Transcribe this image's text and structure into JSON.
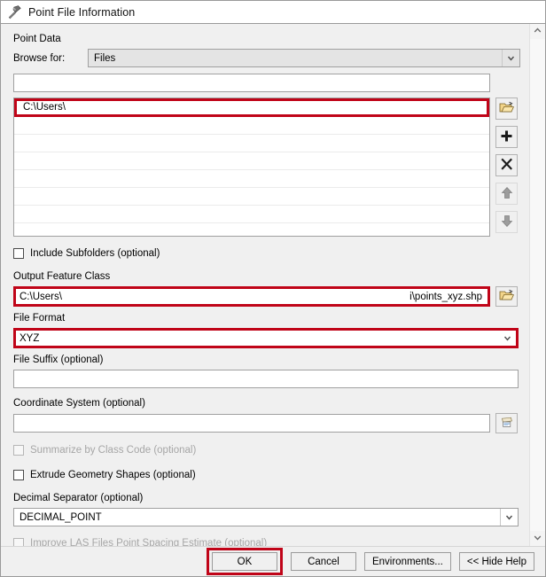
{
  "window": {
    "title": "Point File Information",
    "icon": "hammer-icon"
  },
  "colors": {
    "highlight_red": "#c00418",
    "dialog_background": "#f0f0f0",
    "field_background": "#ffffff",
    "combo_disabled_background": "#e4e4e4"
  },
  "point_data": {
    "group_label": "Point Data",
    "browse_for_label": "Browse for:",
    "browse_for_value": "Files",
    "path_input_value": "",
    "list_rows": [
      {
        "value": "C:\\Users\\",
        "selected": true
      },
      {
        "value": "",
        "selected": false
      },
      {
        "value": "",
        "selected": false
      },
      {
        "value": "",
        "selected": false
      },
      {
        "value": "",
        "selected": false
      },
      {
        "value": "",
        "selected": false
      },
      {
        "value": "",
        "selected": false
      }
    ],
    "tools": [
      {
        "name": "open-folder-icon",
        "title": "Browse"
      },
      {
        "name": "plus-icon",
        "title": "Add"
      },
      {
        "name": "close-x-icon",
        "title": "Remove"
      },
      {
        "name": "arrow-up-icon",
        "title": "Move Up"
      },
      {
        "name": "arrow-down-icon",
        "title": "Move Down"
      }
    ]
  },
  "include_subfolders": {
    "label": "Include Subfolders (optional)",
    "checked": false,
    "enabled": true
  },
  "output_feature_class": {
    "label": "Output Feature Class",
    "value_left": "C:\\Users\\",
    "value_right": "i\\points_xyz.shp",
    "browse_icon": "open-folder-icon"
  },
  "file_format": {
    "label": "File Format",
    "value": "XYZ"
  },
  "file_suffix": {
    "label": "File Suffix (optional)",
    "value": ""
  },
  "coordinate_system": {
    "label": "Coordinate System (optional)",
    "value": "",
    "browse_icon": "coordinate-system-icon"
  },
  "summarize_by_class_code": {
    "label": "Summarize by Class Code (optional)",
    "checked": false,
    "enabled": false
  },
  "extrude_geometry_shapes": {
    "label": "Extrude Geometry Shapes (optional)",
    "checked": false,
    "enabled": true
  },
  "decimal_separator": {
    "label": "Decimal Separator (optional)",
    "value": "DECIMAL_POINT"
  },
  "improve_las_spacing": {
    "label": "Improve LAS Files Point Spacing Estimate (optional)",
    "checked": false,
    "enabled": false
  },
  "footer": {
    "ok_label": "OK",
    "cancel_label": "Cancel",
    "environments_label": "Environments...",
    "hide_help_label": "<< Hide Help"
  },
  "scrollbar": {
    "up_icon": "chevron-up-icon",
    "down_icon": "chevron-down-icon"
  }
}
